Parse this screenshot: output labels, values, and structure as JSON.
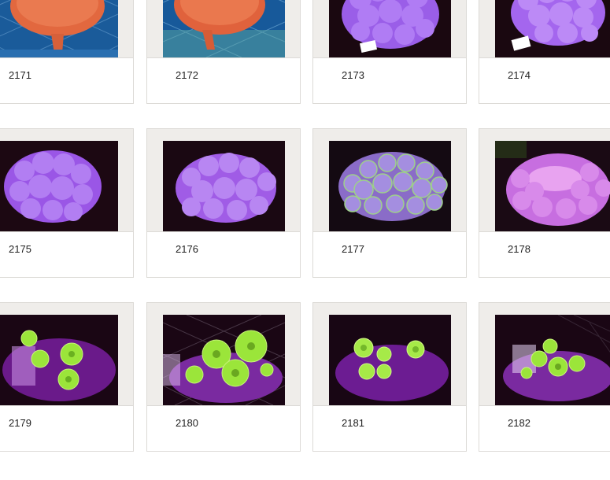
{
  "products": [
    {
      "id": "2171",
      "photo": "red-sea-fan-coral"
    },
    {
      "id": "2172",
      "photo": "red-sea-fan-coral"
    },
    {
      "id": "2173",
      "photo": "purple-bubble-coral"
    },
    {
      "id": "2174",
      "photo": "purple-bubble-coral"
    },
    {
      "id": "2175",
      "photo": "purple-bubble-coral"
    },
    {
      "id": "2176",
      "photo": "purple-bubble-coral"
    },
    {
      "id": "2177",
      "photo": "green-tip-bubble-coral"
    },
    {
      "id": "2178",
      "photo": "pink-bubble-coral"
    },
    {
      "id": "2179",
      "photo": "green-mushroom-coral"
    },
    {
      "id": "2180",
      "photo": "green-mushroom-coral"
    },
    {
      "id": "2181",
      "photo": "green-mushroom-coral"
    },
    {
      "id": "2182",
      "photo": "green-mushroom-coral"
    }
  ],
  "colors": {
    "frame": "#efedea",
    "border": "#dcdad6",
    "red_coral": "#e2683f",
    "purple_bubble": "#a96cf0",
    "green_mushroom": "#9be53a",
    "violet_light": "#7a1a9a"
  }
}
